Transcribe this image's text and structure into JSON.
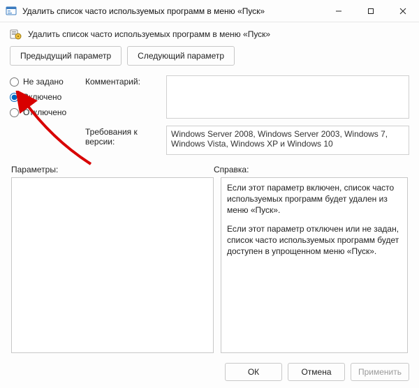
{
  "window": {
    "title": "Удалить список часто используемых программ в меню «Пуск»"
  },
  "header": {
    "caption": "Удалить список часто используемых программ в меню «Пуск»"
  },
  "nav": {
    "prev": "Предыдущий параметр",
    "next": "Следующий параметр"
  },
  "radios": {
    "not_configured": "Не задано",
    "enabled": "Включено",
    "disabled": "Отключено",
    "selected": "enabled"
  },
  "labels": {
    "comment": "Комментарий:",
    "requirements": "Требования к версии:",
    "options": "Параметры:",
    "help": "Справка:"
  },
  "fields": {
    "comment": "",
    "requirements": "Windows Server 2008, Windows Server 2003, Windows 7, Windows Vista, Windows XP и Windows 10"
  },
  "help": {
    "p1": "Если этот параметр включен, список часто используемых программ будет удален из меню «Пуск».",
    "p2": "Если этот параметр отключен или не задан, список часто используемых программ будет доступен в упрощенном меню «Пуск»."
  },
  "buttons": {
    "ok": "ОК",
    "cancel": "Отмена",
    "apply": "Применить"
  },
  "colors": {
    "accent": "#0067c0",
    "arrow": "#d80000"
  }
}
